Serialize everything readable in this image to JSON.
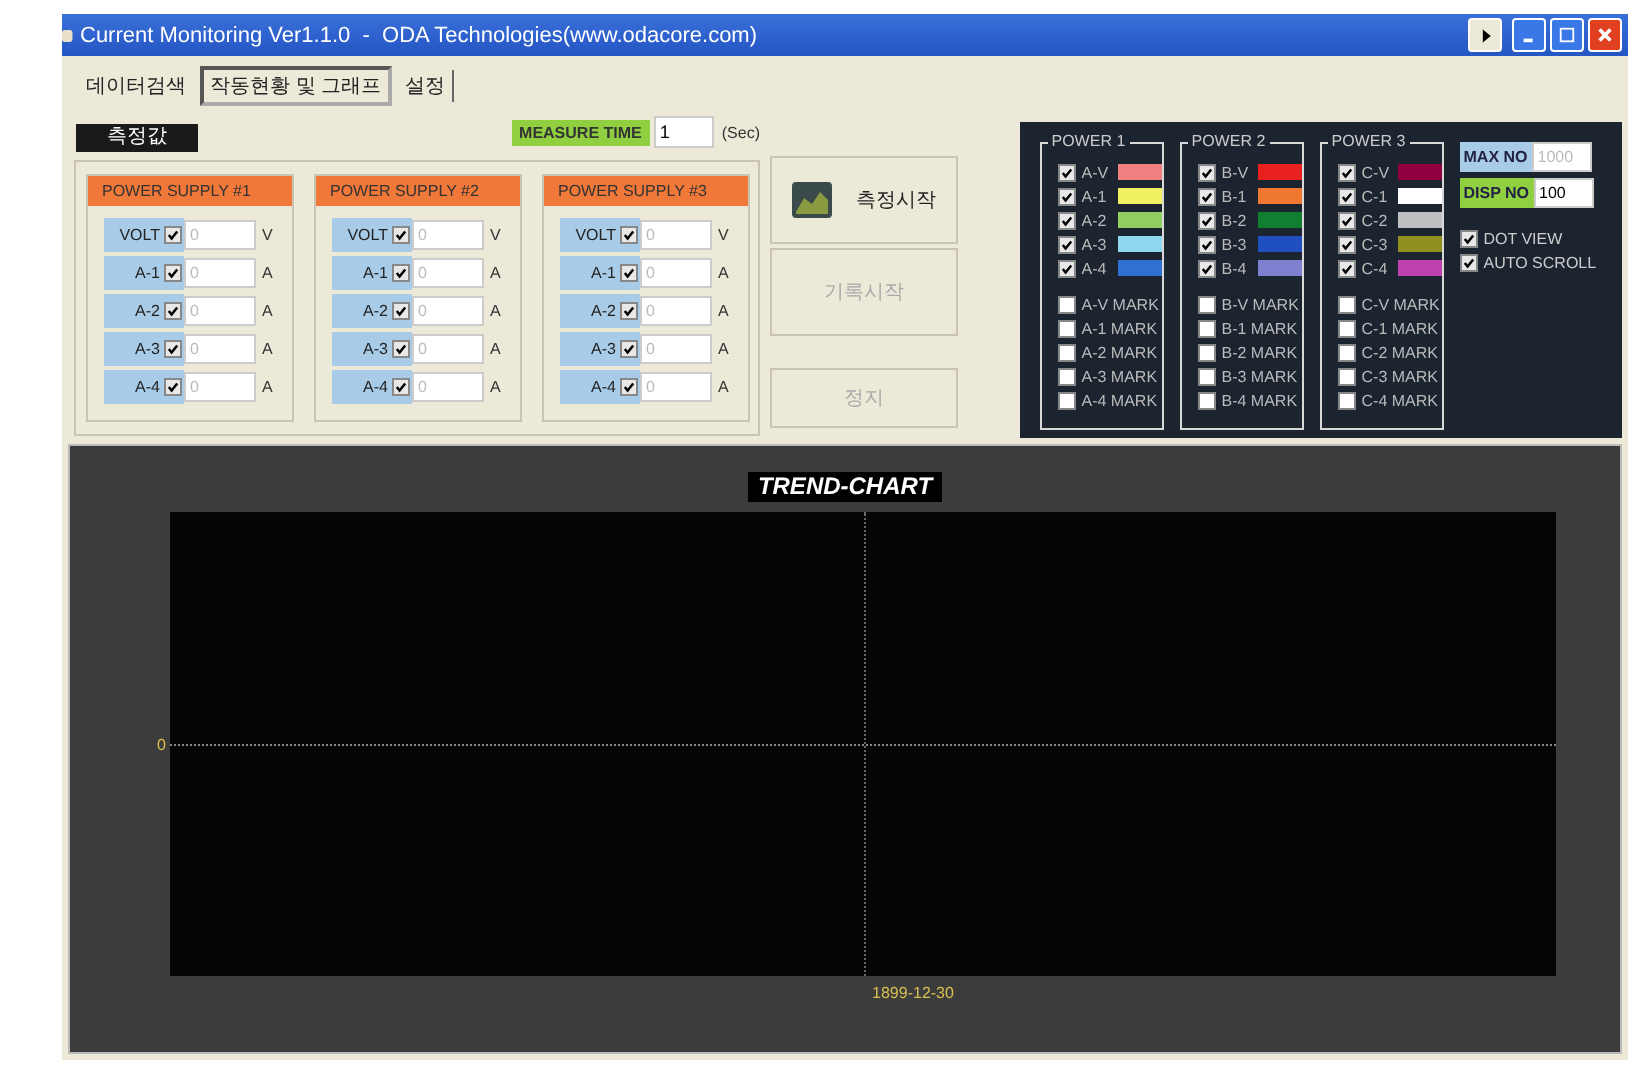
{
  "window": {
    "title": "Current Monitoring Ver1.1.0  -  ODA Technologies(www.odacore.com)"
  },
  "tabs": [
    {
      "label": "데이터검색",
      "selected": false
    },
    {
      "label": "작동현황 및 그래프",
      "selected": true
    },
    {
      "label": "설정",
      "selected": false
    }
  ],
  "measured_label": "측정값",
  "measure_time": {
    "label": "MEASURE TIME",
    "value": "1",
    "unit": "(Sec)"
  },
  "power_supplies": [
    {
      "title": "POWER SUPPLY #1",
      "fields_disabled": true,
      "channels": [
        {
          "label": "VOLT",
          "checked": true,
          "value": "0",
          "unit": "V"
        },
        {
          "label": "A-1",
          "checked": true,
          "value": "0",
          "unit": "A"
        },
        {
          "label": "A-2",
          "checked": true,
          "value": "0",
          "unit": "A"
        },
        {
          "label": "A-3",
          "checked": true,
          "value": "0",
          "unit": "A"
        },
        {
          "label": "A-4",
          "checked": true,
          "value": "0",
          "unit": "A"
        }
      ]
    },
    {
      "title": "POWER SUPPLY #2",
      "fields_disabled": true,
      "channels": [
        {
          "label": "VOLT",
          "checked": true,
          "value": "0",
          "unit": "V"
        },
        {
          "label": "A-1",
          "checked": true,
          "value": "0",
          "unit": "A"
        },
        {
          "label": "A-2",
          "checked": true,
          "value": "0",
          "unit": "A"
        },
        {
          "label": "A-3",
          "checked": true,
          "value": "0",
          "unit": "A"
        },
        {
          "label": "A-4",
          "checked": true,
          "value": "0",
          "unit": "A"
        }
      ]
    },
    {
      "title": "POWER SUPPLY #3",
      "fields_disabled": true,
      "channels": [
        {
          "label": "VOLT",
          "checked": true,
          "value": "0",
          "unit": "V"
        },
        {
          "label": "A-1",
          "checked": true,
          "value": "0",
          "unit": "A"
        },
        {
          "label": "A-2",
          "checked": true,
          "value": "0",
          "unit": "A"
        },
        {
          "label": "A-3",
          "checked": true,
          "value": "0",
          "unit": "A"
        },
        {
          "label": "A-4",
          "checked": true,
          "value": "0",
          "unit": "A"
        }
      ]
    }
  ],
  "buttons": [
    {
      "label": "측정시작",
      "disabled": false,
      "icon": true
    },
    {
      "label": "기록시작",
      "disabled": true,
      "icon": false
    },
    {
      "label": "정지",
      "disabled": true,
      "icon": false
    }
  ],
  "legend_groups": [
    {
      "title": "POWER 1",
      "series": [
        {
          "label": "A-V",
          "checked": true,
          "color": "#f08080"
        },
        {
          "label": "A-1",
          "checked": true,
          "color": "#f0f060"
        },
        {
          "label": "A-2",
          "checked": true,
          "color": "#90d060"
        },
        {
          "label": "A-3",
          "checked": true,
          "color": "#90d8f0"
        },
        {
          "label": "A-4",
          "checked": true,
          "color": "#3070d0"
        }
      ],
      "marks": [
        {
          "label": "A-V MARK",
          "checked": false
        },
        {
          "label": "A-1 MARK",
          "checked": false
        },
        {
          "label": "A-2 MARK",
          "checked": false
        },
        {
          "label": "A-3 MARK",
          "checked": false
        },
        {
          "label": "A-4 MARK",
          "checked": false
        }
      ]
    },
    {
      "title": "POWER 2",
      "series": [
        {
          "label": "B-V",
          "checked": true,
          "color": "#e82020"
        },
        {
          "label": "B-1",
          "checked": true,
          "color": "#f07830"
        },
        {
          "label": "B-2",
          "checked": true,
          "color": "#108030"
        },
        {
          "label": "B-3",
          "checked": true,
          "color": "#2050c0"
        },
        {
          "label": "B-4",
          "checked": true,
          "color": "#8080d0"
        }
      ],
      "marks": [
        {
          "label": "B-V MARK",
          "checked": false
        },
        {
          "label": "B-1 MARK",
          "checked": false
        },
        {
          "label": "B-2 MARK",
          "checked": false
        },
        {
          "label": "B-3 MARK",
          "checked": false
        },
        {
          "label": "B-4 MARK",
          "checked": false
        }
      ]
    },
    {
      "title": "POWER 3",
      "series": [
        {
          "label": "C-V",
          "checked": true,
          "color": "#900040"
        },
        {
          "label": "C-1",
          "checked": true,
          "color": "#ffffff"
        },
        {
          "label": "C-2",
          "checked": true,
          "color": "#c0c0c0"
        },
        {
          "label": "C-3",
          "checked": true,
          "color": "#909020"
        },
        {
          "label": "C-4",
          "checked": true,
          "color": "#c040b0"
        }
      ],
      "marks": [
        {
          "label": "C-V MARK",
          "checked": false
        },
        {
          "label": "C-1 MARK",
          "checked": false
        },
        {
          "label": "C-2 MARK",
          "checked": false
        },
        {
          "label": "C-3 MARK",
          "checked": false
        },
        {
          "label": "C-4 MARK",
          "checked": false
        }
      ]
    }
  ],
  "max_no": {
    "label": "MAX NO",
    "value": "1000",
    "disabled": true
  },
  "disp_no": {
    "label": "DISP NO",
    "value": "100",
    "disabled": false
  },
  "options": [
    {
      "label": "DOT VIEW",
      "checked": true
    },
    {
      "label": "AUTO SCROLL",
      "checked": true
    }
  ],
  "chart": {
    "title": "TREND-CHART",
    "y_tick": "0",
    "x_tick": "1899-12-30"
  }
}
